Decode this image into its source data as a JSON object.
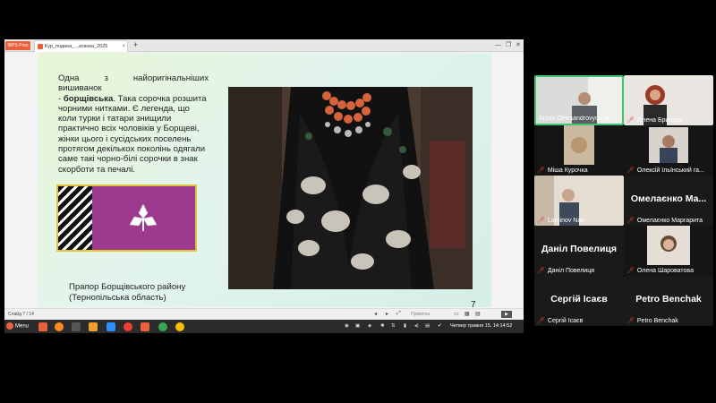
{
  "browser": {
    "app_badge": "WPS Pres",
    "tab_title": "Кур_подина_...атанка_2025",
    "new_tab": "+",
    "minimize": "—",
    "maximize": "❐",
    "close": "✕"
  },
  "slide": {
    "text_lines": [
      "Одна з найоригінальніших вишиванок",
      "- борщівська. Така сорочка розшита",
      "чорними нитками. Є легенда, що",
      "коли турки і татари знищили",
      "практично всіх чоловіків у Борщеві,",
      "жінки цього і сусідських поселень",
      "протягом декількох поколінь одягали",
      "саме такі чорно-білі сорочки в знак",
      "скорботи та печалі."
    ],
    "caption_line1": "Прапор Борщівського району",
    "caption_line2": "(Тернопільська область)",
    "page_number": "7"
  },
  "statusbar": {
    "slide_label": "Слайд 7 / 14",
    "notes_label": "Примітка"
  },
  "taskbar": {
    "menu_label": "Menu",
    "clock": "Четвер травня 15, 14:14:52",
    "icons": [
      "files-icon",
      "firefox-icon",
      "terminal-icon",
      "folder-icon",
      "zoom-icon",
      "chrome-icon",
      "wps-icon",
      "chrome-icon",
      "chrome-icon"
    ]
  },
  "participants": [
    {
      "name": "Anton Oleksandrovych M...",
      "active": true,
      "video": true
    },
    {
      "name": "Олена Бригада",
      "active": false,
      "video": true
    },
    {
      "name": "Міша Курочка",
      "active": false,
      "video": true
    },
    {
      "name": "Олексій Ільїнський га...",
      "active": false,
      "video": true
    },
    {
      "name": "Lantinov Nan",
      "active": false,
      "video": true
    },
    {
      "name": "Омелаєнко Маргарита",
      "big": "Омелаєнко Ма...",
      "active": false,
      "video": false
    },
    {
      "name": "Даніл Повелиця",
      "big": "Даніл Повелиця",
      "active": false,
      "video": false
    },
    {
      "name": "Олена Шароватова",
      "active": false,
      "video": true
    },
    {
      "name": "Сергій Ісаєв",
      "big": "Сергій Ісаєв",
      "active": false,
      "video": false
    },
    {
      "name": "Petro Benchak",
      "big": "Petro Benchak",
      "active": false,
      "video": false
    }
  ],
  "colors": {
    "active_border": "#3ec46d",
    "flag_purple": "#9b3a8e",
    "flag_gold": "#e3c23a",
    "muted_mic": "#e04040"
  }
}
